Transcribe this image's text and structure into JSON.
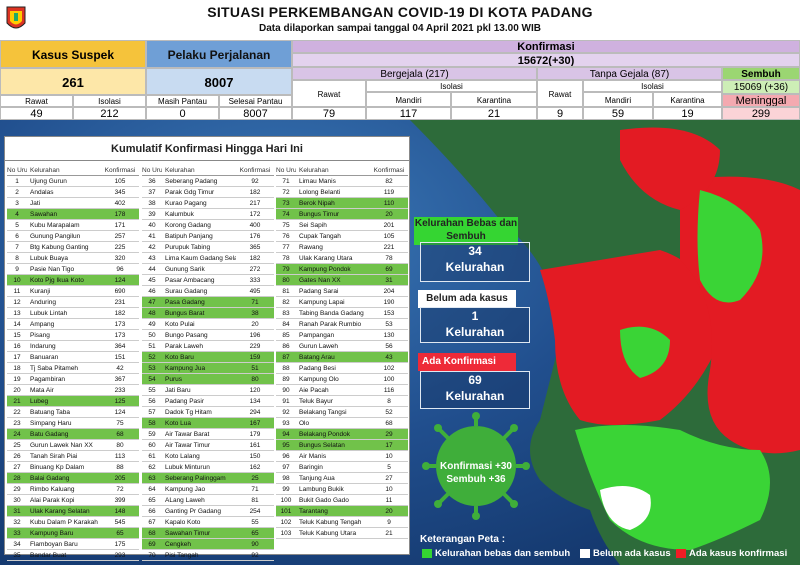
{
  "header": {
    "title": "SITUASI PERKEMBANGAN COVID-19 DI KOTA PADANG",
    "subtitle": "Data dilaporkan sampai tanggal 04 April 2021 pkl 13.00 WIB"
  },
  "summary": {
    "suspek": {
      "label": "Kasus Suspek",
      "total": "261",
      "rawat_label": "Rawat",
      "rawat": "49",
      "isolasi_label": "Isolasi",
      "isolasi": "212"
    },
    "perjalanan": {
      "label": "Pelaku Perjalanan",
      "total": "8007",
      "pantau_label": "Masih Pantau",
      "pantau": "0",
      "selesai_label": "Selesai Pantau",
      "selesai": "8007"
    },
    "konfirmasi": {
      "label": "Konfirmasi",
      "total": "15672(+30)"
    },
    "bergejala": {
      "label": "Bergejala (217)",
      "rawat_label": "Rawat",
      "rawat": "79",
      "isolasi_label": "Isolasi",
      "mandiri_label": "Mandiri",
      "mandiri": "117",
      "karantina_label": "Karantina",
      "karantina": "21"
    },
    "tanpa_gejala": {
      "label": "Tanpa Gejala (87)",
      "rawat_label": "Rawat",
      "rawat": "9",
      "isolasi_label": "Isolasi",
      "mandiri_label": "Mandiri",
      "mandiri": "59",
      "karantina_label": "Karantina",
      "karantina": "19"
    },
    "sembuh": {
      "label": "Sembuh",
      "total": "15069 (+36)"
    },
    "meninggal": {
      "label": "Meninggal",
      "total": "299"
    }
  },
  "table": {
    "title": "Kumulatif Konfirmasi Hingga Hari Ini",
    "headers": [
      "No Urut",
      "Kelurahan",
      "Konfirmasi"
    ],
    "col1": [
      {
        "no": "1",
        "name": "Ujung Gurun",
        "val": "105",
        "g": false
      },
      {
        "no": "2",
        "name": "Andalas",
        "val": "345",
        "g": false
      },
      {
        "no": "3",
        "name": "Jati",
        "val": "402",
        "g": false
      },
      {
        "no": "4",
        "name": "Sawahan",
        "val": "178",
        "g": true
      },
      {
        "no": "5",
        "name": "Kubu Marapalam",
        "val": "171",
        "g": false
      },
      {
        "no": "6",
        "name": "Gunung Pangilun",
        "val": "257",
        "g": false
      },
      {
        "no": "7",
        "name": "Btg Kabung Ganting",
        "val": "225",
        "g": false
      },
      {
        "no": "8",
        "name": "Lubuk Buaya",
        "val": "320",
        "g": false
      },
      {
        "no": "9",
        "name": "Pasie Nan Tigo",
        "val": "96",
        "g": false
      },
      {
        "no": "10",
        "name": "Koto Pjg Ikua Koto",
        "val": "124",
        "g": true
      },
      {
        "no": "11",
        "name": "Kuranji",
        "val": "690",
        "g": false
      },
      {
        "no": "12",
        "name": "Anduring",
        "val": "231",
        "g": false
      },
      {
        "no": "13",
        "name": "Lubuk Lintah",
        "val": "182",
        "g": false
      },
      {
        "no": "14",
        "name": "Ampang",
        "val": "173",
        "g": false
      },
      {
        "no": "15",
        "name": "Pisang",
        "val": "173",
        "g": false
      },
      {
        "no": "16",
        "name": "Indarung",
        "val": "364",
        "g": false
      },
      {
        "no": "17",
        "name": "Banuaran",
        "val": "151",
        "g": false
      },
      {
        "no": "18",
        "name": "Tj Saba Pitameh",
        "val": "42",
        "g": false
      },
      {
        "no": "19",
        "name": "Pagambiran",
        "val": "367",
        "g": false
      },
      {
        "no": "20",
        "name": "Mata Air",
        "val": "233",
        "g": false
      },
      {
        "no": "21",
        "name": "Lubeg",
        "val": "125",
        "g": true
      },
      {
        "no": "22",
        "name": "Batuang Taba",
        "val": "124",
        "g": false
      },
      {
        "no": "23",
        "name": "Simpang Haru",
        "val": "75",
        "g": false
      },
      {
        "no": "24",
        "name": "Batu Gadang",
        "val": "68",
        "g": true
      },
      {
        "no": "25",
        "name": "Gurun Lawek Nan XX",
        "val": "80",
        "g": false
      },
      {
        "no": "26",
        "name": "Tanah Sirah Piai",
        "val": "113",
        "g": false
      },
      {
        "no": "27",
        "name": "Binuang Kp Dalam",
        "val": "88",
        "g": false
      },
      {
        "no": "28",
        "name": "Balai Gadang",
        "val": "205",
        "g": true
      },
      {
        "no": "29",
        "name": "Rimbo Kaluang",
        "val": "72",
        "g": false
      },
      {
        "no": "30",
        "name": "Alai Parak Kopi",
        "val": "399",
        "g": false
      },
      {
        "no": "31",
        "name": "Ulak Karang Selatan",
        "val": "148",
        "g": true
      },
      {
        "no": "32",
        "name": "Kubu Dalam P Karakah",
        "val": "545",
        "g": false
      },
      {
        "no": "33",
        "name": "Kampung Baru",
        "val": "65",
        "g": true
      },
      {
        "no": "34",
        "name": "Flamboyan Baru",
        "val": "175",
        "g": false
      },
      {
        "no": "35",
        "name": "Bandar Buat",
        "val": "293",
        "g": false
      }
    ],
    "col2": [
      {
        "no": "36",
        "name": "Seberang Padang",
        "val": "92",
        "g": false
      },
      {
        "no": "37",
        "name": "Parak Gdg Timur",
        "val": "182",
        "g": false
      },
      {
        "no": "38",
        "name": "Kurao Pagang",
        "val": "217",
        "g": false
      },
      {
        "no": "39",
        "name": "Kalumbuk",
        "val": "172",
        "g": false
      },
      {
        "no": "40",
        "name": "Korong Gadang",
        "val": "400",
        "g": false
      },
      {
        "no": "41",
        "name": "Batipuh Panjang",
        "val": "176",
        "g": false
      },
      {
        "no": "42",
        "name": "Purupuk Tabing",
        "val": "365",
        "g": false
      },
      {
        "no": "43",
        "name": "Lima Kaum Gadang Selatan",
        "val": "182",
        "g": false
      },
      {
        "no": "44",
        "name": "Gunung Sarik",
        "val": "272",
        "g": false
      },
      {
        "no": "45",
        "name": "Pasar Ambacang",
        "val": "333",
        "g": false
      },
      {
        "no": "46",
        "name": "Surau Gadang",
        "val": "495",
        "g": false
      },
      {
        "no": "47",
        "name": "Pasa Gadang",
        "val": "71",
        "g": true
      },
      {
        "no": "48",
        "name": "Bungus Barat",
        "val": "38",
        "g": true
      },
      {
        "no": "49",
        "name": "Koto Pulai",
        "val": "20",
        "g": false
      },
      {
        "no": "50",
        "name": "Bungo Pasang",
        "val": "196",
        "g": false
      },
      {
        "no": "51",
        "name": "Parak Laweh",
        "val": "229",
        "g": false
      },
      {
        "no": "52",
        "name": "Koto Baru",
        "val": "159",
        "g": true
      },
      {
        "no": "53",
        "name": "Kampung Jua",
        "val": "51",
        "g": true
      },
      {
        "no": "54",
        "name": "Purus",
        "val": "80",
        "g": true
      },
      {
        "no": "55",
        "name": "Jati Baru",
        "val": "120",
        "g": false
      },
      {
        "no": "56",
        "name": "Padang Pasir",
        "val": "134",
        "g": false
      },
      {
        "no": "57",
        "name": "Dadok Tg Hitam",
        "val": "294",
        "g": false
      },
      {
        "no": "58",
        "name": "Koto Lua",
        "val": "167",
        "g": true
      },
      {
        "no": "59",
        "name": "Air Tawar Barat",
        "val": "179",
        "g": false
      },
      {
        "no": "60",
        "name": "Air Tawar Timur",
        "val": "161",
        "g": false
      },
      {
        "no": "61",
        "name": "Koto Lalang",
        "val": "150",
        "g": false
      },
      {
        "no": "62",
        "name": "Lubuk Minturun",
        "val": "162",
        "g": false
      },
      {
        "no": "63",
        "name": "Seberang Palinggam",
        "val": "25",
        "g": true
      },
      {
        "no": "64",
        "name": "Kampung Jao",
        "val": "71",
        "g": false
      },
      {
        "no": "65",
        "name": "ALang Laweh",
        "val": "81",
        "g": false
      },
      {
        "no": "66",
        "name": "Ganting Pr Gadang",
        "val": "254",
        "g": false
      },
      {
        "no": "67",
        "name": "Kapalo Koto",
        "val": "55",
        "g": false
      },
      {
        "no": "68",
        "name": "Sawahan Timur",
        "val": "65",
        "g": true
      },
      {
        "no": "69",
        "name": "Cengkeh",
        "val": "90",
        "g": true
      },
      {
        "no": "70",
        "name": "Pisi Tangah",
        "val": "92",
        "g": false
      }
    ],
    "col3": [
      {
        "no": "71",
        "name": "Limau Manis",
        "val": "82",
        "g": false
      },
      {
        "no": "72",
        "name": "Lolong Belanti",
        "val": "119",
        "g": false
      },
      {
        "no": "73",
        "name": "Berok Nipah",
        "val": "110",
        "g": true
      },
      {
        "no": "74",
        "name": "Bungus Timur",
        "val": "20",
        "g": true
      },
      {
        "no": "75",
        "name": "Sei Sapih",
        "val": "201",
        "g": false
      },
      {
        "no": "76",
        "name": "Cupak Tangah",
        "val": "105",
        "g": false
      },
      {
        "no": "77",
        "name": "Rawang",
        "val": "221",
        "g": false
      },
      {
        "no": "78",
        "name": "Ulak Karang Utara",
        "val": "78",
        "g": false
      },
      {
        "no": "79",
        "name": "Kampung Pondok",
        "val": "69",
        "g": true
      },
      {
        "no": "80",
        "name": "Gates Nan XX",
        "val": "31",
        "g": true
      },
      {
        "no": "81",
        "name": "Padang Sarai",
        "val": "204",
        "g": false
      },
      {
        "no": "82",
        "name": "Kampung Lapai",
        "val": "190",
        "g": false
      },
      {
        "no": "83",
        "name": "Tabing Banda Gadang",
        "val": "153",
        "g": false
      },
      {
        "no": "84",
        "name": "Ranah Parak Rumbio",
        "val": "53",
        "g": false
      },
      {
        "no": "85",
        "name": "Pampangan",
        "val": "130",
        "g": false
      },
      {
        "no": "86",
        "name": "Gurun Laweh",
        "val": "56",
        "g": false
      },
      {
        "no": "87",
        "name": "Batang Arau",
        "val": "43",
        "g": true
      },
      {
        "no": "88",
        "name": "Padang Besi",
        "val": "102",
        "g": false
      },
      {
        "no": "89",
        "name": "Kampung Olo",
        "val": "100",
        "g": false
      },
      {
        "no": "90",
        "name": "Aie Pacah",
        "val": "116",
        "g": false
      },
      {
        "no": "91",
        "name": "Teluk Bayur",
        "val": "8",
        "g": false
      },
      {
        "no": "92",
        "name": "Belakang Tangsi",
        "val": "52",
        "g": false
      },
      {
        "no": "93",
        "name": "Olo",
        "val": "68",
        "g": false
      },
      {
        "no": "94",
        "name": "Belakang Pondok",
        "val": "29",
        "g": true
      },
      {
        "no": "95",
        "name": "Bungus Selatan",
        "val": "17",
        "g": true
      },
      {
        "no": "96",
        "name": "Air Manis",
        "val": "10",
        "g": false
      },
      {
        "no": "97",
        "name": "Baringin",
        "val": "5",
        "g": false
      },
      {
        "no": "98",
        "name": "Tanjung Aua",
        "val": "27",
        "g": false
      },
      {
        "no": "99",
        "name": "Lambung Bukik",
        "val": "10",
        "g": false
      },
      {
        "no": "100",
        "name": "Bukit Gado Gado",
        "val": "11",
        "g": false
      },
      {
        "no": "101",
        "name": "Tarantang",
        "val": "20",
        "g": true
      },
      {
        "no": "102",
        "name": "Teluk Kabung Tengah",
        "val": "9",
        "g": false
      },
      {
        "no": "103",
        "name": "Teluk Kabung Utara",
        "val": "21",
        "g": false
      }
    ]
  },
  "map": {
    "bebas_label": "Kelurahan Bebas dan Sembuh",
    "bebas_count": "34",
    "belum_label": "Belum ada kasus",
    "belum_count": "1",
    "ada_label": "Ada Konfirmasi",
    "ada_count": "69",
    "kelurahan_word": "Kelurahan",
    "virus_line1": "Konfirmasi +30",
    "virus_line2": "Sembuh +36"
  },
  "legend": {
    "title": "Keterangan Peta :",
    "items": [
      {
        "label": "Kelurahan bebas dan sembuh",
        "color": "#35d532"
      },
      {
        "label": "Belum ada kasus",
        "color": "#ffffff"
      },
      {
        "label": "Ada kasus konfirmasi",
        "color": "#ee1c25"
      }
    ]
  },
  "colors": {
    "suspek": "#f5c33b",
    "perjalanan": "#6f9fd6",
    "konfirmasi": "#cfb1df",
    "sembuh": "#aee08a",
    "meninggal": "#f4a9b0"
  }
}
